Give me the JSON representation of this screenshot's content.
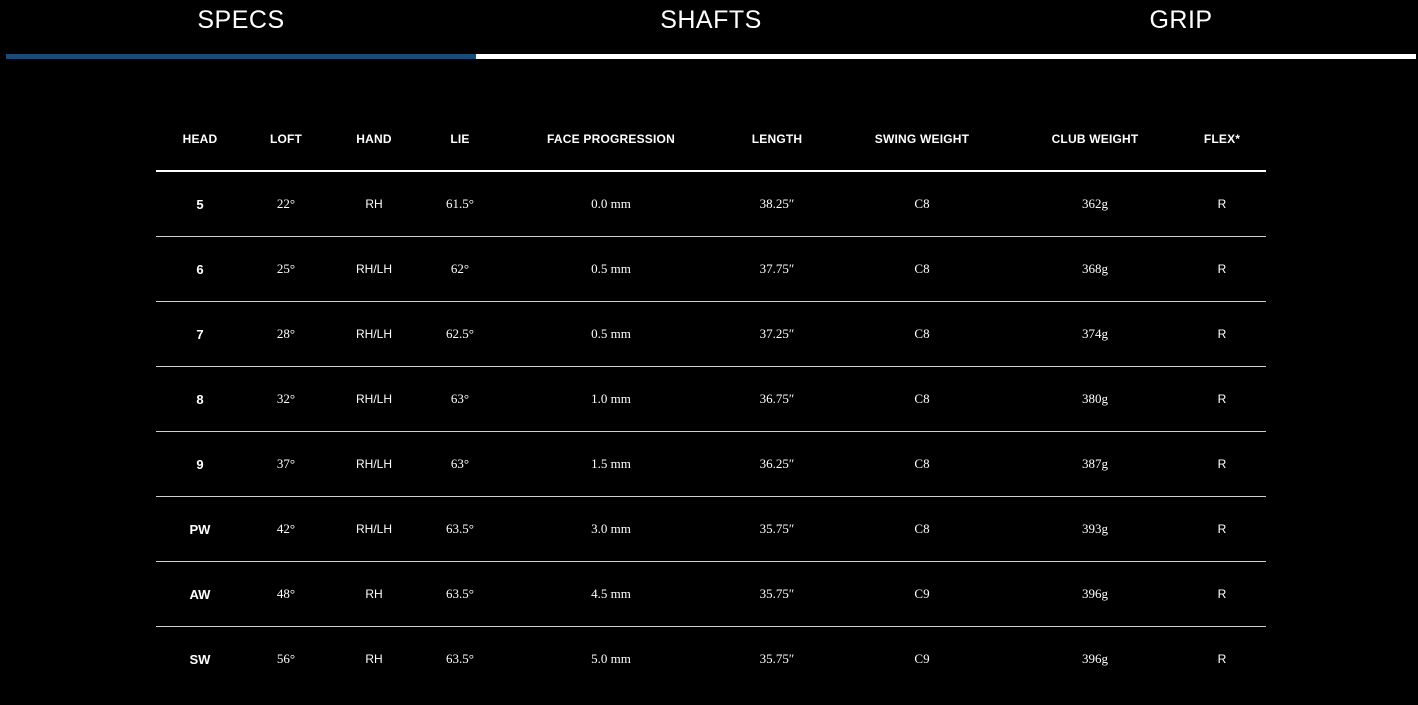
{
  "colors": {
    "background": "#000000",
    "active_tab_underline": "#1a4c7a",
    "tab_underline": "#ffffff",
    "text": "#ffffff"
  },
  "tabs": [
    {
      "label": "SPECS",
      "active": true
    },
    {
      "label": "SHAFTS",
      "active": false
    },
    {
      "label": "GRIP",
      "active": false
    }
  ],
  "table": {
    "columns": [
      "HEAD",
      "LOFT",
      "HAND",
      "LIE",
      "FACE PROGRESSION",
      "LENGTH",
      "SWING WEIGHT",
      "CLUB WEIGHT",
      "FLEX*"
    ],
    "rows": [
      [
        "5",
        "22°",
        "RH",
        "61.5°",
        "0.0 mm",
        "38.25″",
        "C8",
        "362g",
        "R"
      ],
      [
        "6",
        "25°",
        "RH/LH",
        "62°",
        "0.5 mm",
        "37.75″",
        "C8",
        "368g",
        "R"
      ],
      [
        "7",
        "28°",
        "RH/LH",
        "62.5°",
        "0.5 mm",
        "37.25″",
        "C8",
        "374g",
        "R"
      ],
      [
        "8",
        "32°",
        "RH/LH",
        "63°",
        "1.0 mm",
        "36.75″",
        "C8",
        "380g",
        "R"
      ],
      [
        "9",
        "37°",
        "RH/LH",
        "63°",
        "1.5 mm",
        "36.25″",
        "C8",
        "387g",
        "R"
      ],
      [
        "PW",
        "42°",
        "RH/LH",
        "63.5°",
        "3.0 mm",
        "35.75″",
        "C8",
        "393g",
        "R"
      ],
      [
        "AW",
        "48°",
        "RH",
        "63.5°",
        "4.5 mm",
        "35.75″",
        "C9",
        "396g",
        "R"
      ],
      [
        "SW",
        "56°",
        "RH",
        "63.5°",
        "5.0 mm",
        "35.75″",
        "C9",
        "396g",
        "R"
      ]
    ]
  }
}
